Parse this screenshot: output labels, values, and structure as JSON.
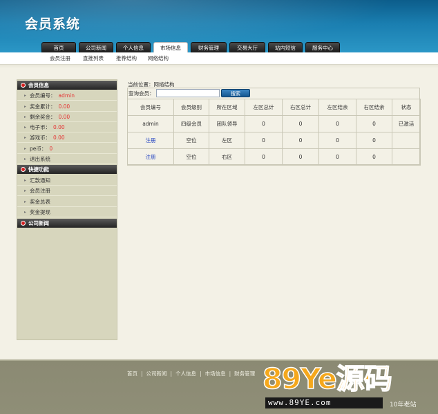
{
  "header": {
    "title": "会员系统",
    "nav": [
      {
        "label": "首页",
        "active": false
      },
      {
        "label": "公司新闻",
        "active": false
      },
      {
        "label": "个人信息",
        "active": false
      },
      {
        "label": "市场信息",
        "active": true
      },
      {
        "label": "财务管理",
        "active": false
      },
      {
        "label": "交易大厅",
        "active": false
      },
      {
        "label": "站内短信",
        "active": false
      },
      {
        "label": "服务中心",
        "active": false
      }
    ],
    "subnav": [
      "会员注册",
      "直推列表",
      "推荐结构",
      "网络结构"
    ]
  },
  "sidebar": {
    "member_info": {
      "title": "会员信息",
      "items": [
        {
          "label": "会员编号：",
          "value": "admin"
        },
        {
          "label": "奖金累计：",
          "value": "0.00"
        },
        {
          "label": "剩余奖金：",
          "value": "0.00"
        },
        {
          "label": "电子币：",
          "value": "0.00"
        },
        {
          "label": "游戏币：",
          "value": "0.00"
        },
        {
          "label": "pe币：",
          "value": "0"
        },
        {
          "label": "退出系统",
          "value": ""
        }
      ]
    },
    "quick": {
      "title": "快捷功能",
      "items": [
        "汇款通知",
        "会员注册",
        "奖金总表",
        "奖金提现"
      ]
    },
    "news": {
      "title": "公司新闻"
    }
  },
  "main": {
    "breadcrumb": "当前位置：网络结构",
    "search": {
      "label": "查询会员：",
      "value": "",
      "button": "搜索"
    },
    "table": {
      "headers": [
        "会员编号",
        "会员级别",
        "所在区域",
        "左区总计",
        "右区总计",
        "左区结余",
        "右区结余",
        "状态"
      ],
      "rows": [
        [
          "admin",
          "四级会员",
          "团队领导",
          "0",
          "0",
          "0",
          "0",
          "已激活"
        ],
        [
          "注册",
          "空位",
          "左区",
          "0",
          "0",
          "0",
          "0",
          ""
        ],
        [
          "注册",
          "空位",
          "右区",
          "0",
          "0",
          "0",
          "0",
          ""
        ]
      ]
    }
  },
  "footer": {
    "links": [
      "首页",
      "公司新闻",
      "个人信息",
      "市场信息",
      "财务管理"
    ]
  },
  "watermark": {
    "brand": "89Ye源码",
    "url": "www.89YE.com",
    "tagline": "10年老站"
  }
}
